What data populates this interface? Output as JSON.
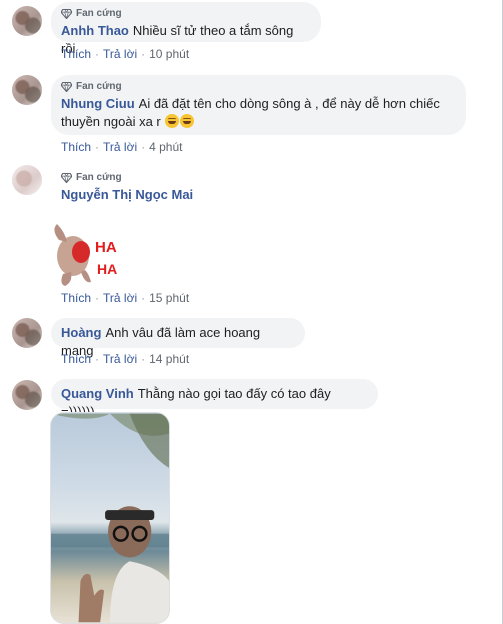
{
  "badge_label": "Fan cứng",
  "actions": {
    "like": "Thích",
    "reply": "Trả lời",
    "separator": "·"
  },
  "comments": [
    {
      "name": "Anhh Thao",
      "text": "Nhiều sĩ tử theo a tắm sông rồi",
      "badge": true,
      "time": "10 phút"
    },
    {
      "name": "Nhung Ciuu",
      "text_line1": "Ai đã đặt tên cho dòng sông à , để này dễ hơn chiếc",
      "text_line2": "thuyền ngoài xa r",
      "badge": true,
      "time": "4 phút"
    },
    {
      "name": "Nguyễn Thị Ngọc Mai",
      "badge": true,
      "sticker_text_top": "HA",
      "sticker_text_bottom": "HA",
      "time": "15 phút"
    },
    {
      "name": "Hoàng",
      "text": "Anh vâu đã làm ace hoang mang",
      "badge": false,
      "time": "14 phút"
    },
    {
      "name": "Quang Vinh",
      "text": "Thằng nào gọi tao đấy có tao đây =))))))",
      "badge": false
    }
  ],
  "colors": {
    "name": "#385898",
    "bubble": "#f2f3f5",
    "meta": "#606770",
    "emoji": "#f7c531"
  },
  "icons": [
    "diamond-icon",
    "grin-emoji-icon"
  ]
}
